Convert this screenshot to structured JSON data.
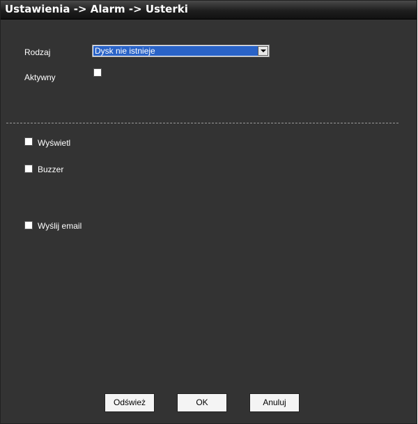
{
  "title": "Ustawienia -> Alarm -> Usterki",
  "type_label": "Rodzaj",
  "type_value": "Dysk nie istnieje",
  "active_label": "Aktywny",
  "display_label": "Wyświetl",
  "buzzer_label": "Buzzer",
  "email_label": "Wyślij email",
  "buttons": {
    "refresh": "Odśwież",
    "ok": "OK",
    "cancel": "Anuluj"
  }
}
